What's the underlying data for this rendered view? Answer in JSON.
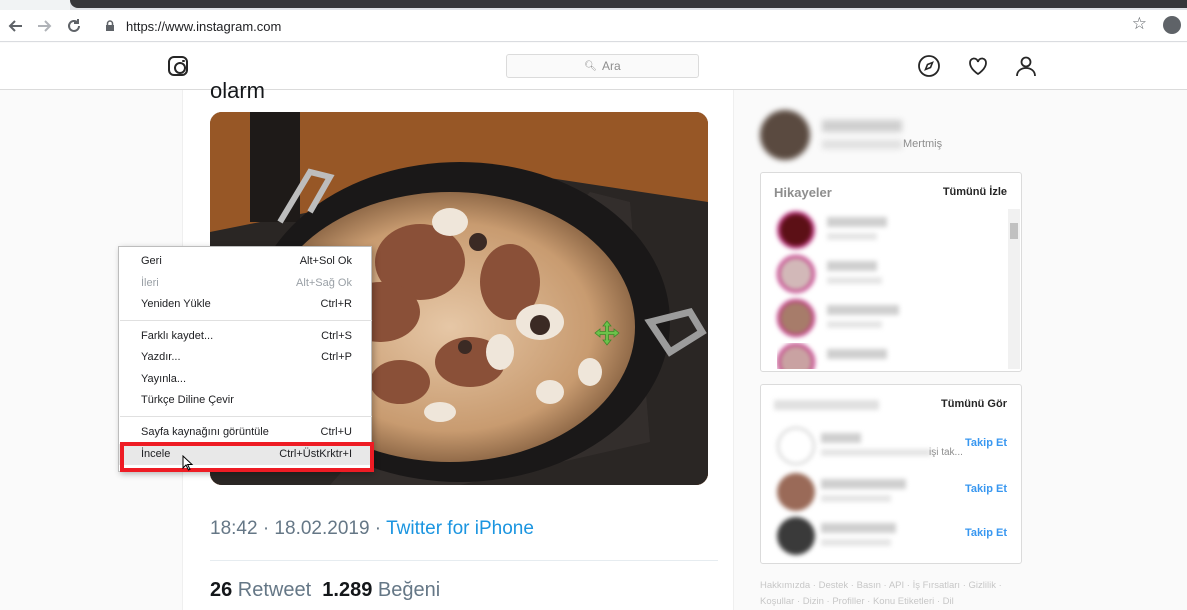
{
  "browser": {
    "url": "https://www.instagram.com",
    "back_icon": "arrow-left-icon",
    "forward_icon": "arrow-right-icon",
    "reload_icon": "reload-icon",
    "bookmark_icon": "star-icon",
    "profile_icon": "account-circle-icon"
  },
  "instagram": {
    "search_placeholder": "Ara",
    "logo_icon": "instagram-logo-icon",
    "nav_icons": [
      "compass-icon",
      "heart-icon",
      "person-icon"
    ]
  },
  "post": {
    "title_fragment": "olarm",
    "time": "18:42 · 18.02.2019 · ",
    "source": "Twitter for iPhone",
    "retweet_count": "26",
    "retweet_label": " Retweet  ",
    "like_count": "1.289",
    "like_label": " Beğeni"
  },
  "sidebar": {
    "profile_suffix": "Mertmiş",
    "stories": {
      "title": "Hikayeler",
      "link": "Tümünü İzle"
    },
    "suggestions": {
      "link": "Tümünü Gör",
      "follow_label": "Takip Et",
      "partial_text": "işi tak..."
    },
    "footer": [
      "Hakkımızda · Destek · Basın · API · İş Fırsatları · Gizlilik ·",
      "Koşullar · Dizin · Profiller · Konu Etiketleri · Dil"
    ]
  },
  "context_menu": {
    "items": [
      {
        "label": "Geri",
        "shortcut": "Alt+Sol Ok",
        "disabled": false
      },
      {
        "label": "İleri",
        "shortcut": "Alt+Sağ Ok",
        "disabled": true
      },
      {
        "label": "Yeniden Yükle",
        "shortcut": "Ctrl+R",
        "disabled": false
      },
      {
        "label": "Farklı kaydet...",
        "shortcut": "Ctrl+S",
        "disabled": false
      },
      {
        "label": "Yazdır...",
        "shortcut": "Ctrl+P",
        "disabled": false
      },
      {
        "label": "Yayınla...",
        "shortcut": "",
        "disabled": false
      },
      {
        "label": "Türkçe Diline Çevir",
        "shortcut": "",
        "disabled": false
      },
      {
        "label": "Sayfa kaynağını görüntüle",
        "shortcut": "Ctrl+U",
        "disabled": false
      },
      {
        "label": "İncele",
        "shortcut": "Ctrl+ÜstKrktr+I",
        "disabled": false
      }
    ],
    "highlight_color": "#ee1c24"
  }
}
